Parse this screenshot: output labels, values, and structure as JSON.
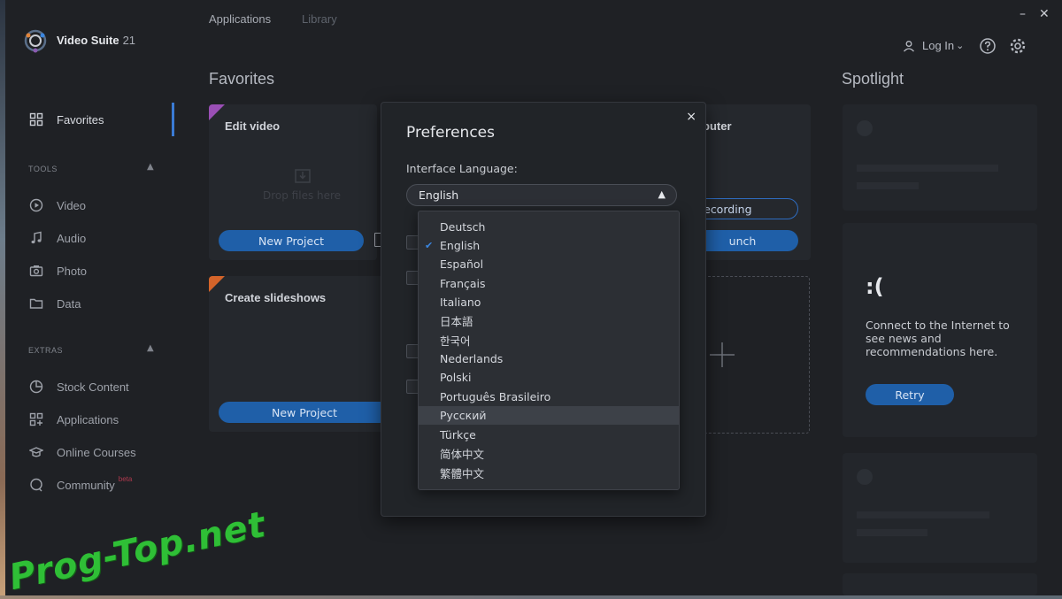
{
  "app": {
    "name": "Video Suite",
    "version": "21"
  },
  "top_tabs": [
    "Applications",
    "Library"
  ],
  "header": {
    "login_label": "Log In",
    "login_chevron": "⌄"
  },
  "sidebar": {
    "favorites": "Favorites",
    "tools_label": "TOOLS",
    "tools": [
      "Video",
      "Audio",
      "Photo",
      "Data"
    ],
    "extras_label": "EXTRAS",
    "extras": [
      "Stock Content",
      "Applications",
      "Online Courses",
      "Community"
    ],
    "community_badge": "beta"
  },
  "favorites": {
    "heading": "Favorites",
    "card1": {
      "title": "Edit video",
      "drop_hint": "Drop files here",
      "button": "New Project"
    },
    "card2": {
      "title": "Create slideshows",
      "button": "New Project"
    },
    "card3": {
      "title_fragment": "puter",
      "outline_button": "Recording",
      "button_fragment": "unch"
    }
  },
  "spotlight": {
    "heading": "Spotlight",
    "face": ":(",
    "message": "Connect to the Internet to see news and recommendations here.",
    "retry": "Retry"
  },
  "preferences": {
    "title": "Preferences",
    "close": "×",
    "language_label": "Interface Language:",
    "selected": "English",
    "options": [
      "Deutsch",
      "English",
      "Español",
      "Français",
      "Italiano",
      "日本語",
      "한국어",
      "Nederlands",
      "Polski",
      "Português Brasileiro",
      "Русский",
      "Türkçe",
      "简体中文",
      "繁體中文"
    ],
    "checked_option": "English",
    "hovered_option": "Русский"
  },
  "watermark": "Prog-Top.net",
  "colors": {
    "accent": "#1f5fa8",
    "active_bar": "#3a7bd5",
    "check": "#3a86e0",
    "watermark": "#2fbf36"
  }
}
